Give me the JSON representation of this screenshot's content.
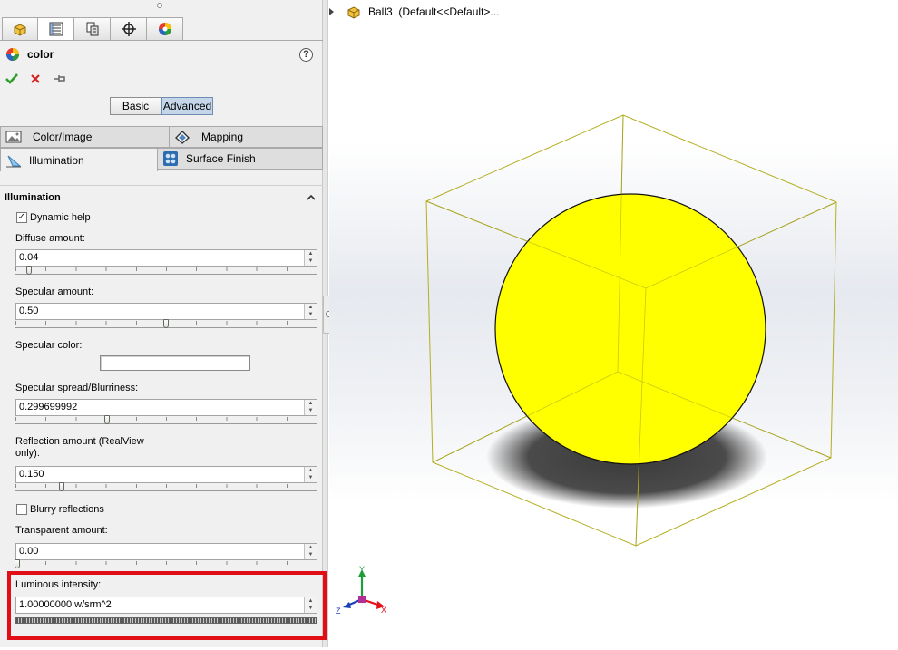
{
  "feature": {
    "title": "color",
    "help_symbol": "?",
    "actions": {
      "ok_icon": "checkmark-icon",
      "cancel_icon": "x-icon",
      "pin_icon": "pushpin-icon"
    }
  },
  "manager_tabs": [
    {
      "icon": "part-feature-manager-icon"
    },
    {
      "icon": "property-manager-icon",
      "active": true
    },
    {
      "icon": "configuration-manager-icon"
    },
    {
      "icon": "dimxpert-crosshair-icon"
    },
    {
      "icon": "display-manager-icon"
    }
  ],
  "mode": {
    "basic_label": "Basic",
    "advanced_label": "Advanced",
    "selected": "Advanced"
  },
  "property_tabs": {
    "color_image": "Color/Image",
    "mapping": "Mapping",
    "illumination": "Illumination",
    "surface_finish": "Surface Finish",
    "active": "Illumination"
  },
  "illumination": {
    "section_title": "Illumination",
    "dynamic_help": {
      "label": "Dynamic help",
      "checked": true
    },
    "diffuse": {
      "label": "Diffuse amount:",
      "value": "0.04",
      "slider": 0.04
    },
    "specular": {
      "label": "Specular amount:",
      "value": "0.50",
      "slider": 0.5
    },
    "specular_color": {
      "label": "Specular color:",
      "color": "#ffffff"
    },
    "specular_spread": {
      "label": "Specular spread/Blurriness:",
      "value": "0.299699992",
      "slider": 0.3
    },
    "reflection": {
      "label_line1": "Reflection amount (RealView",
      "label_line2": "only):",
      "value": "0.150",
      "slider": 0.15
    },
    "blurry_reflections": {
      "label": "Blurry reflections",
      "checked": false
    },
    "transparent": {
      "label": "Transparent amount:",
      "value": "0.00",
      "slider": 0.0
    },
    "luminous": {
      "label": "Luminous intensity:",
      "value": "1.00000000 w/srm^2"
    }
  },
  "tree": {
    "item": "Ball3  (Default<<Default>..."
  },
  "colors": {
    "ball": "#ffff00",
    "bounding_box": "#b4ae20",
    "highlight": "#e10e16",
    "triad_x": "#e3101a",
    "triad_y": "#1e9e3a",
    "triad_z": "#1c3fb8"
  },
  "triad": {
    "x": "X",
    "y": "Y",
    "z": "Z"
  }
}
